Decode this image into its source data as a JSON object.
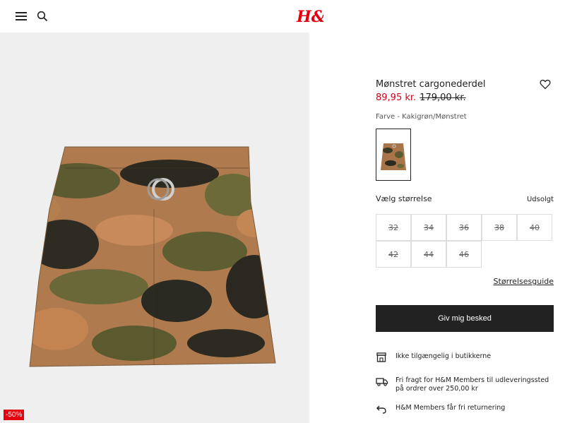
{
  "header": {
    "logo_text": "H&M"
  },
  "product": {
    "title": "Mønstret cargonederdel",
    "price_sale": "89,95 kr.",
    "price_original": "179,00 kr.",
    "color_label": "Farve",
    "color_separator": " - ",
    "color_value": "Kakigrøn/Mønstret",
    "badge": "-50%"
  },
  "sizes": {
    "label": "Vælg størrelse",
    "soldout_label": "Udsolgt",
    "options": [
      "32",
      "34",
      "36",
      "38",
      "40",
      "42",
      "44",
      "46"
    ],
    "guide_label": "Størrelsesguide"
  },
  "actions": {
    "notify_label": "Giv mig besked"
  },
  "info": {
    "store": "Ikke tilgængelig i butikkerne",
    "shipping": "Fri fragt for H&M Members til udleveringssted på ordrer over 250,00 kr",
    "returns": "H&M Members får fri returnering"
  },
  "colors": {
    "accent_red": "#e50010",
    "price_red": "#d6001c",
    "button_dark": "#222222"
  },
  "icons": [
    "menu-icon",
    "search-icon",
    "heart-icon",
    "store-icon",
    "truck-icon",
    "return-icon"
  ]
}
